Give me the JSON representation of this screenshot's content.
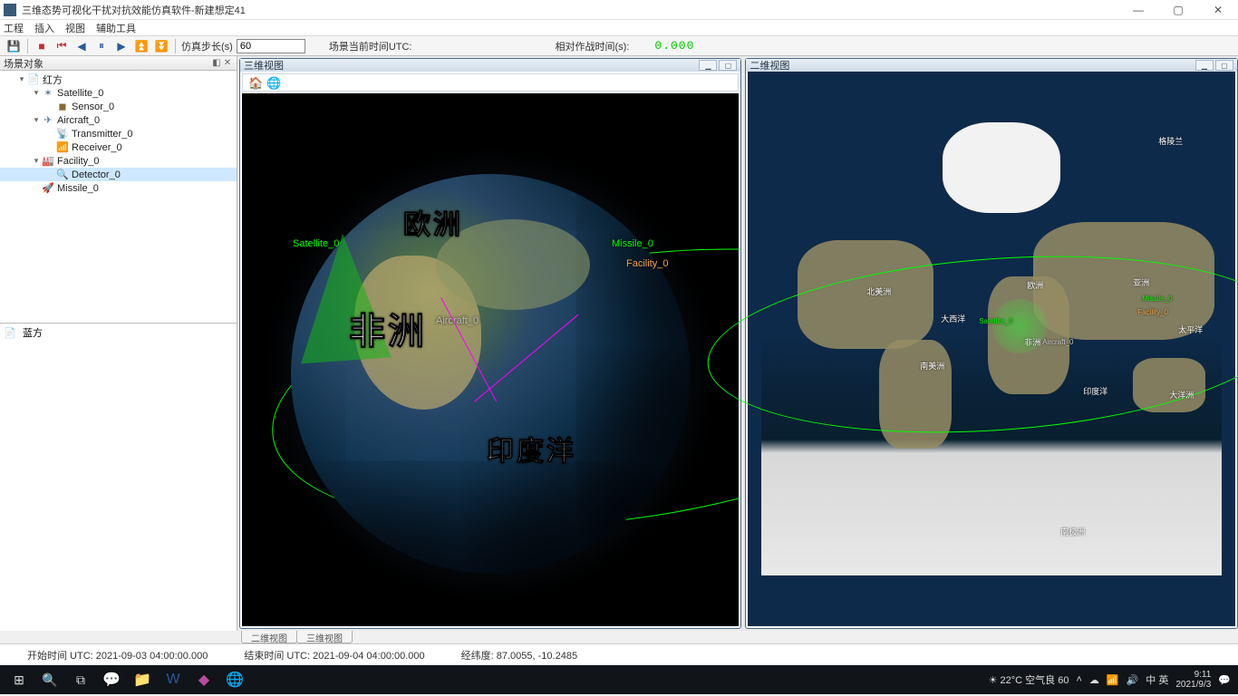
{
  "title": "三维态势可视化干扰对抗效能仿真软件-新建想定41",
  "menus": {
    "m1": "工程",
    "m2": "插入",
    "m3": "视图",
    "m4": "辅助工具"
  },
  "toolbar": {
    "step_label": "仿真步长(s)",
    "step_value": "60",
    "utc_label": "场景当前时间UTC:",
    "rel_label": "相对作战时间(s):",
    "rel_value": "0.000"
  },
  "left": {
    "panel_title": "场景对象",
    "red": "红方",
    "sat": "Satellite_0",
    "sensor": "Sensor_0",
    "air": "Aircraft_0",
    "tx": "Transmitter_0",
    "rx": "Receiver_0",
    "fac": "Facility_0",
    "det": "Detector_0",
    "mis": "Missile_0",
    "blue": "蓝方"
  },
  "views": {
    "v3d_title": "三维视图",
    "v2d_title": "二维视图",
    "tab2d": "二维视图",
    "tab3d": "三维视图"
  },
  "globe": {
    "europe": "欧洲",
    "africa": "非洲",
    "indian": "印度洋",
    "sat": "Satellite_0",
    "air": "Aircraft_0",
    "mis": "Missile_0",
    "fac": "Facility_0"
  },
  "map2d": {
    "na": "北美洲",
    "sa": "南美洲",
    "eu": "欧洲",
    "af": "非洲",
    "as": "亚洲",
    "oc": "大洋洲",
    "ant": "南极洲",
    "pac": "太平洋",
    "atl": "大西洋",
    "ind": "印度洋",
    "gl": "格陵兰",
    "air": "Aircraft_0",
    "fac": "Facility_0",
    "mis": "Missile_0",
    "sat": "Satellite_0"
  },
  "status": {
    "start": "开始时间 UTC: 2021-09-03 04:00:00.000",
    "end": "结束时间 UTC: 2021-09-04 04:00:00.000",
    "coord": "经纬度: 87.0055,  -10.2485"
  },
  "taskbar": {
    "weather": "22°C 空气良 60",
    "ime": "中 英",
    "time": "9:11",
    "date": "2021/9/3"
  }
}
